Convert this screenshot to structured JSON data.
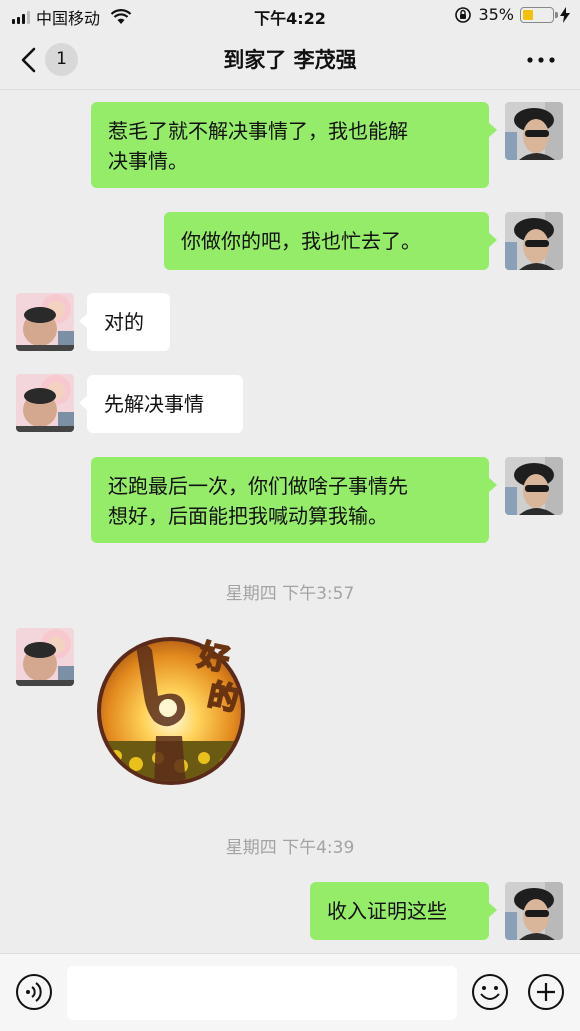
{
  "status_bar": {
    "carrier": "中国移动",
    "time": "下午4:22",
    "battery_percent": "35%",
    "battery_level": 0.35,
    "icons": [
      "signal-icon",
      "wifi-icon",
      "rotation-lock-icon",
      "battery-icon",
      "charging-icon"
    ]
  },
  "nav": {
    "back_badge": "1",
    "title": "到家了 李茂强",
    "more_icon": "more-dots-icon"
  },
  "messages": [
    {
      "side": "mine",
      "text": "惹毛了就不解决事情了，我也能解\n决事情。"
    },
    {
      "side": "mine",
      "text": "你做你的吧，我也忙去了。"
    },
    {
      "side": "theirs",
      "text": "对的"
    },
    {
      "side": "theirs",
      "text": "先解决事情"
    },
    {
      "side": "mine",
      "text": "还跑最后一次，你们做啥子事情先\n想好，后面能把我喊动算我输。"
    },
    {
      "time": "星期四 下午3:57"
    },
    {
      "side": "theirs",
      "sticker": "ok-hand-sunset-sticker",
      "sticker_text": "好的"
    },
    {
      "time": "星期四 下午4:39"
    },
    {
      "side": "mine",
      "text": "收入证明这些"
    }
  ],
  "input_bar": {
    "placeholder": "",
    "icons": [
      "voice-icon",
      "emoji-icon",
      "plus-icon"
    ]
  },
  "colors": {
    "background": "#ededed",
    "my_bubble": "#95ec69",
    "their_bubble": "#ffffff",
    "time_label": "#a3a3a3",
    "battery_fill": "#f2c20a"
  }
}
